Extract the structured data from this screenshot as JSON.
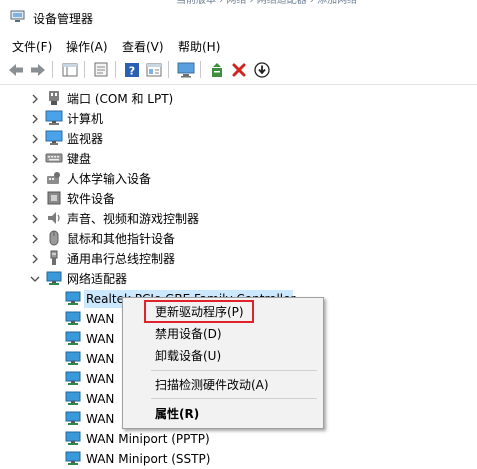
{
  "top_strip_text": "当前版本  ›  网络 › 网络适配器  ›  添加网络",
  "window": {
    "title": "设备管理器",
    "icon": "device-manager-icon"
  },
  "menu": [
    "文件(F)",
    "操作(A)",
    "查看(V)",
    "帮助(H)"
  ],
  "toolbar": [
    "back-arrow-icon",
    "forward-arrow-icon",
    "show-hide-tree-icon",
    "properties-icon",
    "help-icon",
    "view-icon",
    "monitor-scan-icon",
    "update-driver-icon",
    "uninstall-x-icon",
    "download-icon"
  ],
  "tree": {
    "categories": [
      {
        "label": "端口 (COM 和 LPT)",
        "icon": "port-icon",
        "expanded": false
      },
      {
        "label": "计算机",
        "icon": "computer-icon",
        "expanded": false
      },
      {
        "label": "监视器",
        "icon": "monitor-icon",
        "expanded": false
      },
      {
        "label": "键盘",
        "icon": "keyboard-icon",
        "expanded": false
      },
      {
        "label": "人体学输入设备",
        "icon": "hid-icon",
        "expanded": false
      },
      {
        "label": "软件设备",
        "icon": "software-device-icon",
        "expanded": false
      },
      {
        "label": "声音、视频和游戏控制器",
        "icon": "speaker-icon",
        "expanded": false
      },
      {
        "label": "鼠标和其他指针设备",
        "icon": "mouse-icon",
        "expanded": false
      },
      {
        "label": "通用串行总线控制器",
        "icon": "usb-icon",
        "expanded": false
      },
      {
        "label": "网络适配器",
        "icon": "network-adapter-icon",
        "expanded": true
      }
    ],
    "children": [
      {
        "label": "Realtek PCIe GBE Family Controller",
        "selected": true
      },
      {
        "label": "WAN"
      },
      {
        "label": "WAN"
      },
      {
        "label": "WAN"
      },
      {
        "label": "WAN"
      },
      {
        "label": "WAN"
      },
      {
        "label": "WAN"
      },
      {
        "label": "WAN Miniport (PPTP)"
      },
      {
        "label": "WAN Miniport (SSTP)"
      }
    ]
  },
  "context_menu": {
    "items": [
      "更新驱动程序(P)",
      "禁用设备(D)",
      "卸载设备(U)",
      "扫描检测硬件改动(A)",
      "属性(R)"
    ],
    "highlighted_index": 0,
    "highlight_color": "#e0232b"
  },
  "colors": {
    "accent_blue": "#1e72c9",
    "selection_bg": "#cce8ff"
  }
}
